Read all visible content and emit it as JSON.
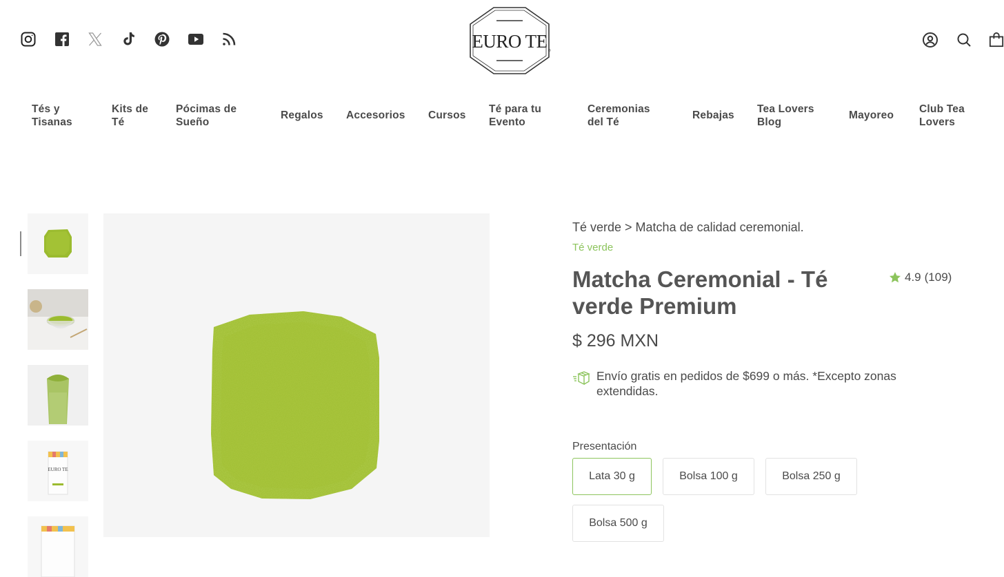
{
  "header": {
    "social_icons": [
      "instagram-icon",
      "facebook-icon",
      "x-twitter-icon",
      "tiktok-icon",
      "pinterest-icon",
      "youtube-icon",
      "rss-icon"
    ],
    "logo_text": "EURO TE",
    "right_icons": [
      "account-icon",
      "search-icon",
      "cart-icon"
    ]
  },
  "nav": {
    "items": [
      {
        "label": "Tés y\nTisanas"
      },
      {
        "label": "Kits de\nTé"
      },
      {
        "label": "Pócimas de\nSueño"
      },
      {
        "label": "Regalos"
      },
      {
        "label": "Accesorios"
      },
      {
        "label": "Cursos"
      },
      {
        "label": "Té para tu\nEvento"
      },
      {
        "label": "Ceremonias\ndel Té"
      },
      {
        "label": "Rebajas"
      },
      {
        "label": "Tea Lovers\nBlog"
      },
      {
        "label": "Mayoreo"
      },
      {
        "label": "Club Tea\nLovers"
      }
    ]
  },
  "product": {
    "breadcrumb": "Té verde > Matcha de calidad ceremonial.",
    "category": "Té verde",
    "title": "Matcha Ceremonial - Té verde Premium",
    "rating": "4.9",
    "review_count": "(109)",
    "price": "$ 296 MXN",
    "shipping_note": "Envío gratis en pedidos de $699 o más. *Excepto zonas extendidas.",
    "presentation_label": "Presentación",
    "options": [
      {
        "label": "Lata 30 g",
        "selected": true
      },
      {
        "label": "Bolsa 100 g",
        "selected": false
      },
      {
        "label": "Bolsa 250 g",
        "selected": false
      },
      {
        "label": "Bolsa 500 g",
        "selected": false
      }
    ]
  },
  "colors": {
    "accent_green": "#8cc45c",
    "matcha": "#9bbb2f",
    "text": "#4a4a4a"
  }
}
